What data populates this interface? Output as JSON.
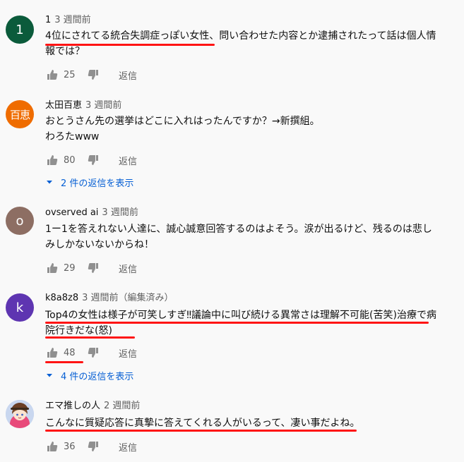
{
  "comments": [
    {
      "avatar_text": "1",
      "avatar_color": "#0b5b3b",
      "author": "1",
      "time": "3 週間前",
      "text": "4位にされてる統合失調症っぽい女性、問い合わせた内容とか逮捕されたって話は個人情報では？",
      "likes": "25",
      "reply_label": "返信"
    },
    {
      "avatar_text": "百恵",
      "avatar_color": "#ef6c00",
      "author": "太田百恵",
      "time": "3 週間前",
      "text": "おとうさん先の選挙はどこに入れはったんですか？→新撰組。\nわろたwww",
      "likes": "80",
      "reply_label": "返信",
      "replies_label": "2 件の返信を表示"
    },
    {
      "avatar_text": "o",
      "avatar_color": "#8d6e63",
      "author": "ovserved ai",
      "time": "3 週間前",
      "text": "1ー1を答えれない人達に、誠心誠意回答するのはよそう。涙が出るけど、残るのは悲しみしかないないからね！",
      "likes": "29",
      "reply_label": "返信"
    },
    {
      "avatar_text": "k",
      "avatar_color": "#5e35b1",
      "author": "k8a8z8",
      "time": "3 週間前（編集済み）",
      "text": "Top4の女性は様子が可笑しすぎ‼︎議論中に叫び続ける異常さは理解不可能(苦笑)治療で病院行きだな(怒)",
      "likes": "48",
      "reply_label": "返信",
      "replies_label": "4 件の返信を表示"
    },
    {
      "avatar_text": "",
      "avatar_color": "#b3c7e6",
      "author": "エマ推しの人",
      "time": "2 週間前",
      "text": "こんなに質疑応答に真摯に答えてくれる人がいるって、凄い事だよね。",
      "likes": "36",
      "reply_label": "返信"
    }
  ],
  "colors": {
    "underline": "#ff1414",
    "link": "#065fd4",
    "muted": "#606060"
  },
  "icons": {
    "like": "thumb-up-icon",
    "dislike": "thumb-down-icon",
    "expand": "caret-down-icon"
  }
}
